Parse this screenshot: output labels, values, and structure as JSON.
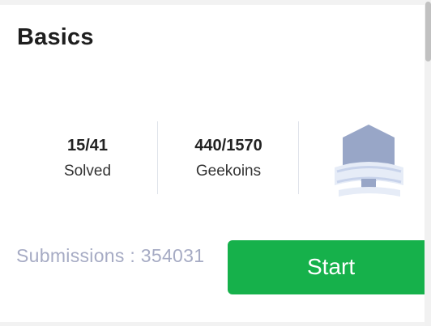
{
  "card": {
    "title": "Basics",
    "stats": [
      {
        "value": "15/41",
        "label": "Solved"
      },
      {
        "value": "440/1570",
        "label": "Geekoins"
      }
    ],
    "badge_icon": "hexagon-badge-icon",
    "submissions": "Submissions : 354031",
    "start_label": "Start"
  },
  "colors": {
    "accent": "#16b14b",
    "muted_text": "#a6abc4",
    "badge": "#98a6c7"
  }
}
